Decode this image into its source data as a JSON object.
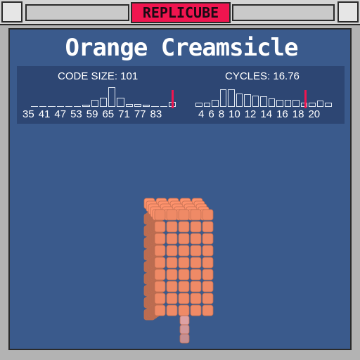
{
  "app": {
    "title": "REPLICUBE"
  },
  "level": {
    "name": "Orange Creamsicle"
  },
  "stats": {
    "code_size": {
      "label": "CODE SIZE: 101",
      "ticks": [
        "35",
        "41",
        "47",
        "53",
        "59",
        "65",
        "71",
        "77",
        "83"
      ],
      "histogram": [
        0.05,
        0.05,
        0.05,
        0.05,
        0.05,
        0.05,
        0.1,
        0.35,
        0.45,
        0.95,
        0.45,
        0.15,
        0.15,
        0.1,
        0.05,
        0.05,
        0.25
      ],
      "marker_fraction": 0.96
    },
    "cycles": {
      "label": "CYCLES: 16.76",
      "ticks": [
        "4",
        "6",
        "8",
        "10",
        "12",
        "14",
        "16",
        "18",
        "20"
      ],
      "histogram": [
        0.2,
        0.2,
        0.35,
        0.85,
        0.85,
        0.65,
        0.6,
        0.55,
        0.5,
        0.4,
        0.35,
        0.35,
        0.35,
        0.2,
        0.2,
        0.3,
        0.2
      ],
      "marker_fraction": 0.79
    }
  },
  "colors": {
    "accent": "#f0154f",
    "panel": "#3a5a8c",
    "cube_orange": "#ef8a66",
    "stick_pink": "#f6b3b6"
  }
}
